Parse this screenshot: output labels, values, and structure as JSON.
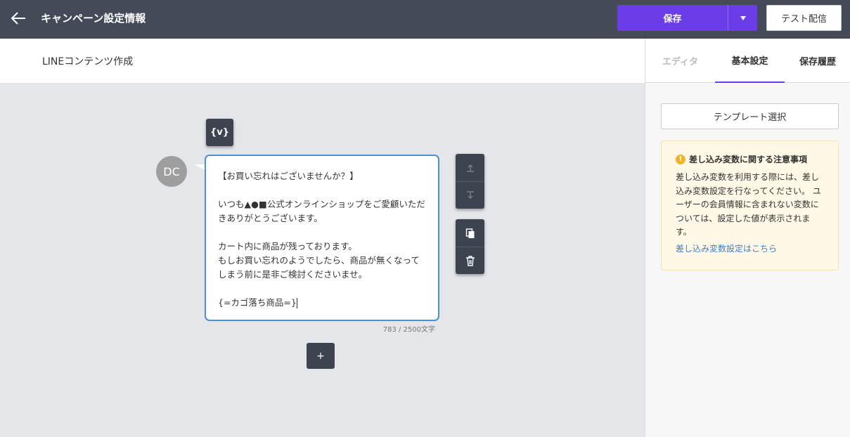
{
  "header": {
    "title": "キャンペーン設定情報",
    "save_label": "保存",
    "test_label": "テスト配信",
    "accent_color": "#6a3de8"
  },
  "editor": {
    "section_title": "LINEコンテンツ作成",
    "variable_button": "{v}",
    "avatar_initials": "DC",
    "message_text": "【お買い忘れはございませんか？】\n\nいつも▲●■公式オンラインショップをご愛顧いただきありがとうございます。\n\nカート内に商品が残っております。\nもしお買い忘れのようでしたら、商品が無くなってしまう前に是非ご検討くださいませ。\n\n{=カゴ落ち商品=}",
    "char_count": "783 / 2500文字",
    "add_label": "+"
  },
  "panel": {
    "tabs": [
      "エディタ",
      "基本設定",
      "保存履歴"
    ],
    "active_tab": "基本設定",
    "template_button": "テンプレート選択",
    "notice": {
      "title": "差し込み変数に関する注意事項",
      "body": "差し込み変数を利用する際には、差し込み変数設定を行なってください。 ユーザーの会員情報に含まれない変数については、設定した値が表示されます。",
      "link": "差し込み変数設定はこちら",
      "icon": "warning-icon"
    }
  }
}
